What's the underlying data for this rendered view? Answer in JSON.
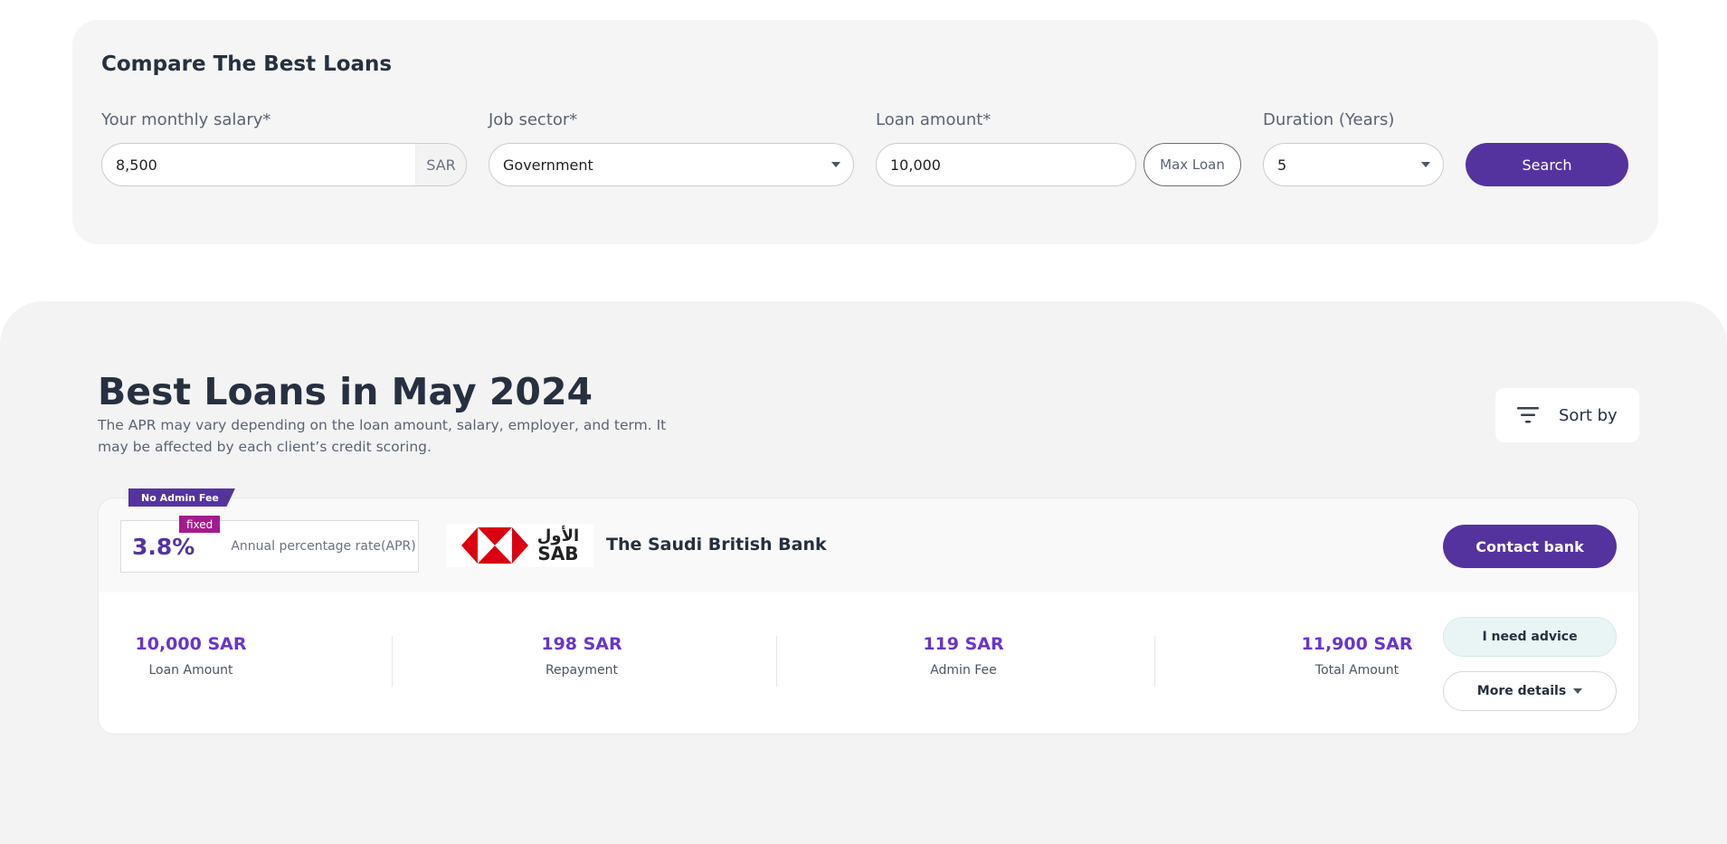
{
  "search": {
    "title": "Compare The Best Loans",
    "salary": {
      "label": "Your monthly salary*",
      "value": "8,500",
      "unit": "SAR"
    },
    "job_sector": {
      "label": "Job sector*",
      "value": "Government"
    },
    "loan_amount": {
      "label": "Loan amount*",
      "value": "10,000",
      "max_loan_label": "Max Loan"
    },
    "duration": {
      "label": "Duration (Years)",
      "value": "5"
    },
    "search_label": "Search"
  },
  "results": {
    "title": "Best Loans in May 2024",
    "description": "The APR may vary depending on the loan amount, salary, employer, and term. It may be affected by each client’s credit scoring.",
    "sort_label": "Sort by"
  },
  "offer": {
    "ribbon": "No Admin Fee",
    "rate_type": "fixed",
    "apr_value": "3.8%",
    "apr_label": "Annual percentage rate(APR)",
    "logo_ar": "الأول",
    "logo_en": "SAB",
    "bank_name": "The Saudi British Bank",
    "contact_label": "Contact bank",
    "stats": [
      {
        "value": "10,000 SAR",
        "label": "Loan Amount"
      },
      {
        "value": "198 SAR",
        "label": "Repayment"
      },
      {
        "value": "119 SAR",
        "label": "Admin Fee"
      },
      {
        "value": "11,900 SAR",
        "label": "Total Amount"
      }
    ],
    "advice_label": "I need advice",
    "details_label": "More details"
  },
  "colors": {
    "brand": "#55339f",
    "accent_value": "#6a35c9",
    "tag": "#a31c8d",
    "logo_red": "#db0011"
  }
}
